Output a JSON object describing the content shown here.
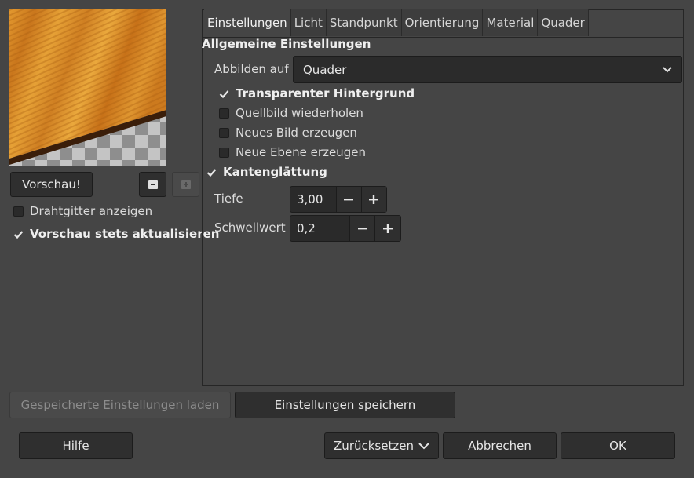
{
  "preview": {
    "button_label": "Vorschau!",
    "wireframe_label": "Drahtgitter anzeigen",
    "wireframe_checked": false,
    "auto_update_label": "Vorschau stets aktualisieren",
    "auto_update_checked": true
  },
  "tabs": [
    {
      "label": "Einstellungen",
      "active": true
    },
    {
      "label": "Licht",
      "active": false
    },
    {
      "label": "Standpunkt",
      "active": false
    },
    {
      "label": "Orientierung",
      "active": false
    },
    {
      "label": "Material",
      "active": false
    },
    {
      "label": "Quader",
      "active": false
    }
  ],
  "settings": {
    "section_title": "Allgemeine Einstellungen",
    "map_to_label": "Abbilden auf",
    "map_to_value": "Quader",
    "transparent_bg": {
      "label": "Transparenter Hintergrund",
      "checked": true
    },
    "tile_source": {
      "label": "Quellbild wiederholen",
      "checked": false
    },
    "new_image": {
      "label": "Neues Bild erzeugen",
      "checked": false
    },
    "new_layer": {
      "label": "Neue Ebene erzeugen",
      "checked": false
    },
    "antialiasing": {
      "label": "Kantenglättung",
      "checked": true
    },
    "depth": {
      "label": "Tiefe",
      "value": "3,00"
    },
    "threshold": {
      "label": "Schwellwert",
      "value": "0,2"
    }
  },
  "footer": {
    "load_label": "Gespeicherte Einstellungen laden",
    "save_label": "Einstellungen speichern",
    "help_label": "Hilfe",
    "reset_label": "Zurücksetzen",
    "cancel_label": "Abbrechen",
    "ok_label": "OK"
  },
  "colors": {
    "background": "#454545",
    "widget": "#2f2f2f",
    "wood": "#d98a2a"
  }
}
